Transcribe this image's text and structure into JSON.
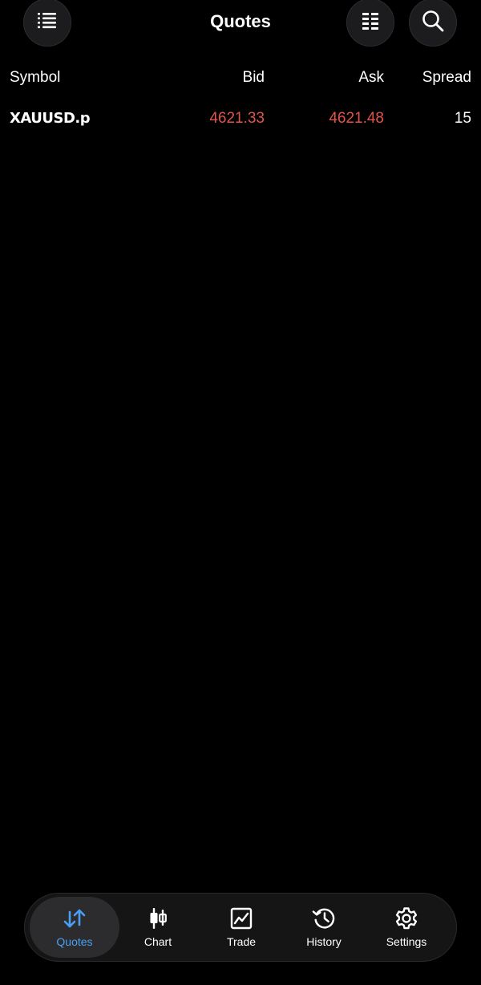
{
  "header": {
    "title": "Quotes",
    "menu_icon": "list-icon",
    "edit_icon": "columns-icon",
    "search_icon": "search-icon"
  },
  "columns": {
    "symbol": "Symbol",
    "bid": "Bid",
    "ask": "Ask",
    "spread": "Spread"
  },
  "quotes": [
    {
      "symbol": "XAUUSD.p",
      "bid": "4621.33",
      "ask": "4621.48",
      "spread": "15",
      "price_color": "#e0544a"
    }
  ],
  "tabs": [
    {
      "label": "Quotes",
      "icon": "arrows-up-down-icon",
      "active": true
    },
    {
      "label": "Chart",
      "icon": "candlestick-icon",
      "active": false
    },
    {
      "label": "Trade",
      "icon": "trend-chart-icon",
      "active": false
    },
    {
      "label": "History",
      "icon": "history-clock-icon",
      "active": false
    },
    {
      "label": "Settings",
      "icon": "gear-icon",
      "active": false
    }
  ],
  "colors": {
    "background": "#000000",
    "accent": "#4a9ff5",
    "price_down": "#e0544a"
  }
}
